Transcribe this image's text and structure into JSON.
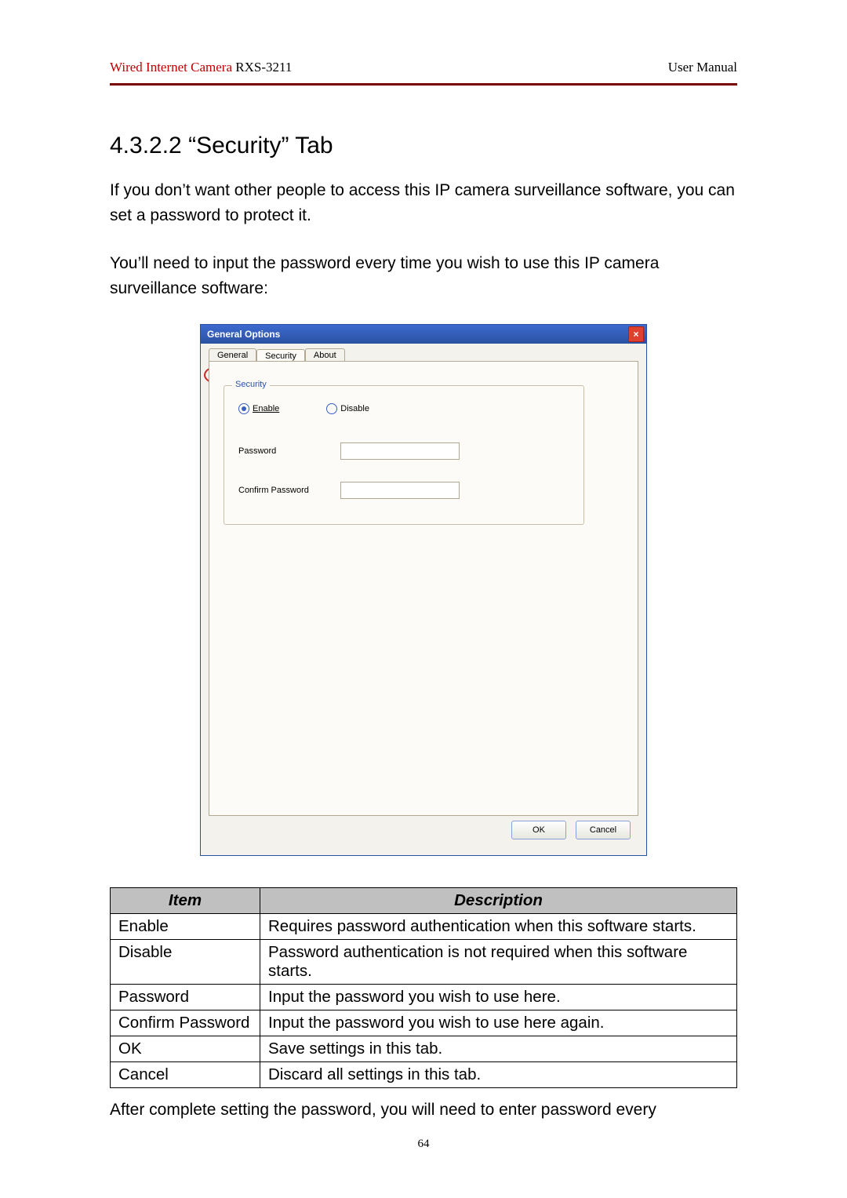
{
  "header": {
    "product": "Wired Internet Camera",
    "model": " RXS-3211",
    "right": "User Manual"
  },
  "section_title": "4.3.2.2 “Security” Tab",
  "para1": "If you don’t want other people to access this IP camera surveillance software, you can set a password to protect it.",
  "para2": "You’ll need to input the password every time you wish to use this IP camera surveillance software:",
  "dialog": {
    "title": "General Options",
    "tabs": {
      "general": "General",
      "security": "Security",
      "about": "About"
    },
    "group_title": "Security",
    "radio_enable": "Enable",
    "radio_disable": "Disable",
    "lbl_password": "Password",
    "lbl_confirm": "Confirm Password",
    "btn_ok": "OK",
    "btn_cancel": "Cancel"
  },
  "table": {
    "head_item": "Item",
    "head_desc": "Description",
    "rows": [
      {
        "item": "Enable",
        "desc": "Requires password authentication when this software starts."
      },
      {
        "item": "Disable",
        "desc": "Password authentication is not required when this software starts."
      },
      {
        "item": "Password",
        "desc": "Input the password you wish to use here."
      },
      {
        "item": "Confirm Password",
        "desc": "Input the password you wish to use here again."
      },
      {
        "item": "OK",
        "desc": "Save settings in this tab."
      },
      {
        "item": "Cancel",
        "desc": "Discard all settings in this tab."
      }
    ]
  },
  "after_table": "After complete setting the password, you will need to enter password every",
  "page_number": "64"
}
